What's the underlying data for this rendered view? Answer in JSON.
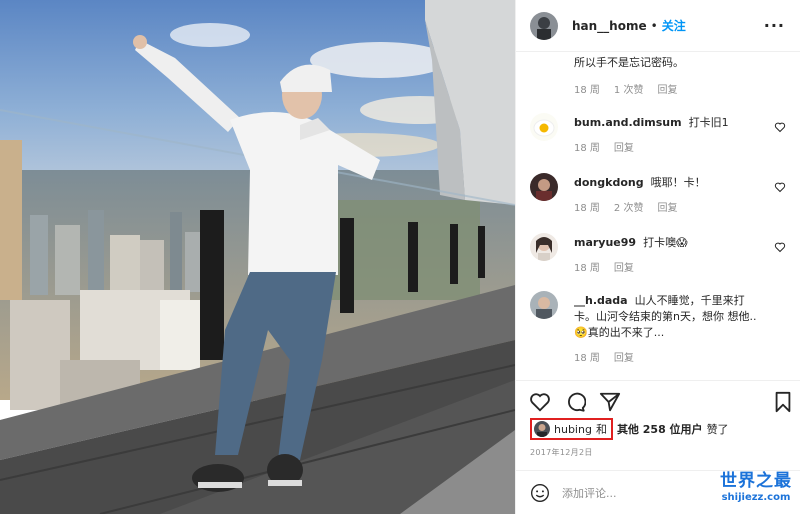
{
  "header": {
    "username": "han__home",
    "separator": "•",
    "follow_label": "关注",
    "more_label": "···"
  },
  "comments": {
    "top_partial": {
      "text": "所以手不是忘记密码。",
      "time": "18 周",
      "likes": "1 次赞",
      "reply": "回复"
    },
    "items": [
      {
        "user": "bum.and.dimsum",
        "text": "打卡旧1",
        "time": "18 周",
        "likes": "",
        "reply": "回复"
      },
      {
        "user": "dongkdong",
        "text": "哦耶！卡！",
        "time": "18 周",
        "likes": "2 次赞",
        "reply": "回复"
      },
      {
        "user": "maryue99",
        "text": "打卡噢😱",
        "time": "18 周",
        "likes": "",
        "reply": "回复"
      },
      {
        "user": "__h.dada",
        "text": "山人不睡觉，千里来打卡。山河令结束的第n天，想你 想他..🥺真的出不来了...",
        "time": "18 周",
        "likes": "",
        "reply": "回复"
      }
    ]
  },
  "actions": {
    "like_icon": "heart-outline-icon",
    "comment_icon": "speech-bubble-icon",
    "share_icon": "paper-plane-icon",
    "save_icon": "bookmark-icon"
  },
  "likes": {
    "user": "hubing",
    "connector": "和",
    "others": "其他 258 位用户",
    "suffix": "赞了"
  },
  "post_date": "2017年12月2日",
  "add_comment": {
    "placeholder": "添加评论...",
    "emoji_icon": "smiley-icon"
  },
  "watermark": {
    "line1": "世界之最",
    "line2": "shijiezz.com"
  },
  "colors": {
    "follow_blue": "#0095f6",
    "highlight_red": "#e02020",
    "watermark_blue": "#1c73d9"
  }
}
